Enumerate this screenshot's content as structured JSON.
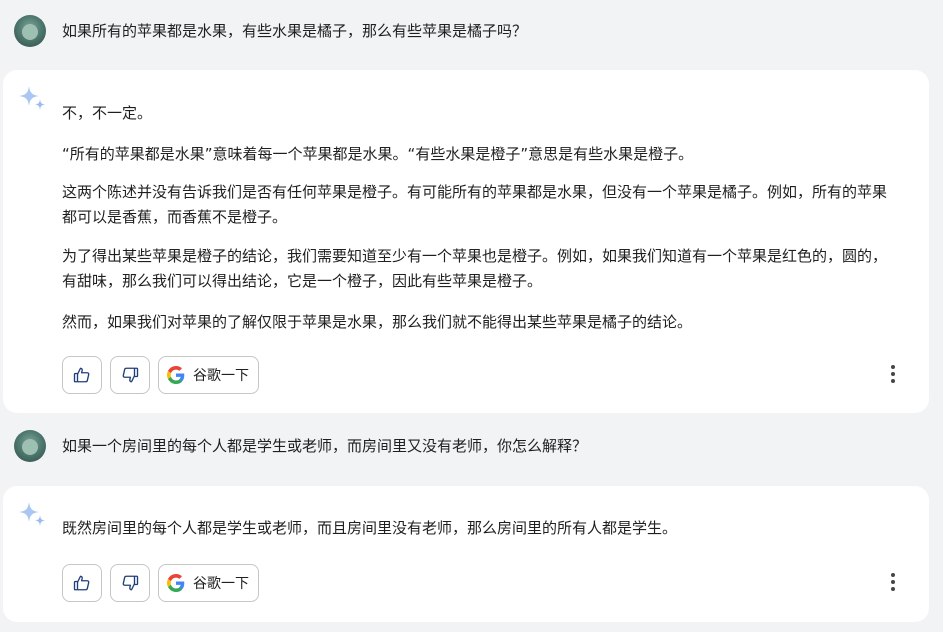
{
  "conversation": [
    {
      "role": "user",
      "avatar_icon": "user-avatar",
      "text": "如果所有的苹果都是水果，有些水果是橘子，那么有些苹果是橘子吗？"
    },
    {
      "role": "assistant",
      "icon": "sparkle-icon",
      "paragraphs": [
        "不，不一定。",
        "“所有的苹果都是水果”意味着每一个苹果都是水果。“有些水果是橙子”意思是有些水果是橙子。",
        "这两个陈述并没有告诉我们是否有任何苹果是橙子。有可能所有的苹果都是水果，但没有一个苹果是橘子。例如，所有的苹果都可以是香蕉，而香蕉不是橙子。",
        "为了得出某些苹果是橙子的结论，我们需要知道至少有一个苹果也是橙子。例如，如果我们知道有一个苹果是红色的，圆的，有甜味，那么我们可以得出结论，它是一个橙子，因此有些苹果是橙子。",
        "然而，如果我们对苹果的了解仅限于苹果是水果，那么我们就不能得出某些苹果是橘子的结论。"
      ],
      "actions": {
        "thumbs_up_icon": "thumbs-up-icon",
        "thumbs_down_icon": "thumbs-down-icon",
        "google_label": "谷歌一下",
        "more_icon": "more-vert-icon"
      }
    },
    {
      "role": "user",
      "avatar_icon": "user-avatar",
      "text": "如果一个房间里的每个人都是学生或老师，而房间里又没有老师，你怎么解释？"
    },
    {
      "role": "assistant",
      "icon": "sparkle-icon",
      "paragraphs": [
        "既然房间里的每个人都是学生或老师，而且房间里没有老师，那么房间里的所有人都是学生。"
      ],
      "actions": {
        "thumbs_up_icon": "thumbs-up-icon",
        "thumbs_down_icon": "thumbs-down-icon",
        "google_label": "谷歌一下",
        "more_icon": "more-vert-icon"
      }
    }
  ],
  "colors": {
    "page_background": "#f1f3f4",
    "card_background": "#ffffff",
    "text": "#1f1f1f",
    "sparkle_light": "#aac6f5",
    "sparkle_dark": "#5e8ee8",
    "button_border": "#c4c7c5",
    "google_blue": "#4285F4",
    "google_red": "#EA4335",
    "google_yellow": "#FBBC05",
    "google_green": "#34A853"
  }
}
